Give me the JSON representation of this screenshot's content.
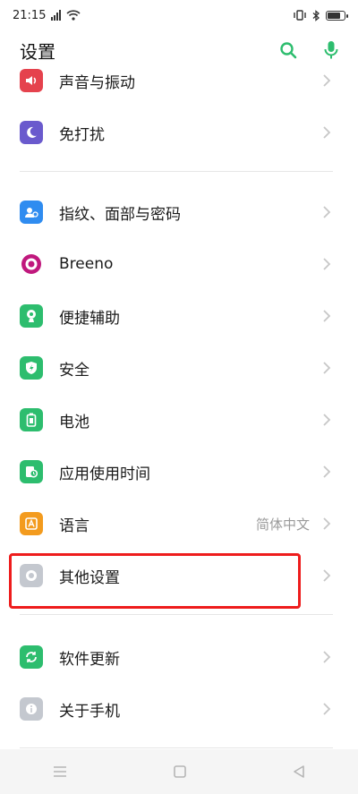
{
  "status_bar": {
    "time": "21:15"
  },
  "header": {
    "title": "设置"
  },
  "settings_items": [
    {
      "label": "声音与振动",
      "icon": "sound-icon",
      "color": "#e5424d",
      "value": ""
    },
    {
      "label": "免打扰",
      "icon": "moon-icon",
      "color": "#6a5acd",
      "value": ""
    },
    {
      "label": "指纹、面部与密码",
      "icon": "fingerprint-face-icon",
      "color": "#2f8cf0",
      "value": ""
    },
    {
      "label": "Breeno",
      "icon": "breeno-icon",
      "color": "#c0187d",
      "value": ""
    },
    {
      "label": "便捷辅助",
      "icon": "assist-icon",
      "color": "#2dbd6e",
      "value": ""
    },
    {
      "label": "安全",
      "icon": "shield-icon",
      "color": "#2dbd6e",
      "value": ""
    },
    {
      "label": "电池",
      "icon": "battery-icon",
      "color": "#2dbd6e",
      "value": ""
    },
    {
      "label": "应用使用时间",
      "icon": "app-time-icon",
      "color": "#2dbd6e",
      "value": ""
    },
    {
      "label": "语言",
      "icon": "language-icon",
      "color": "#f39b1e",
      "value": "简体中文"
    },
    {
      "label": "其他设置",
      "icon": "other-settings-icon",
      "color": "#c4c8cf",
      "value": ""
    },
    {
      "label": "软件更新",
      "icon": "update-icon",
      "color": "#2dbd6e",
      "value": ""
    },
    {
      "label": "关于手机",
      "icon": "info-icon",
      "color": "#c4c8cf",
      "value": ""
    }
  ],
  "colors": {
    "accent": "#2dbd6e",
    "highlight": "#ee1c1c"
  }
}
